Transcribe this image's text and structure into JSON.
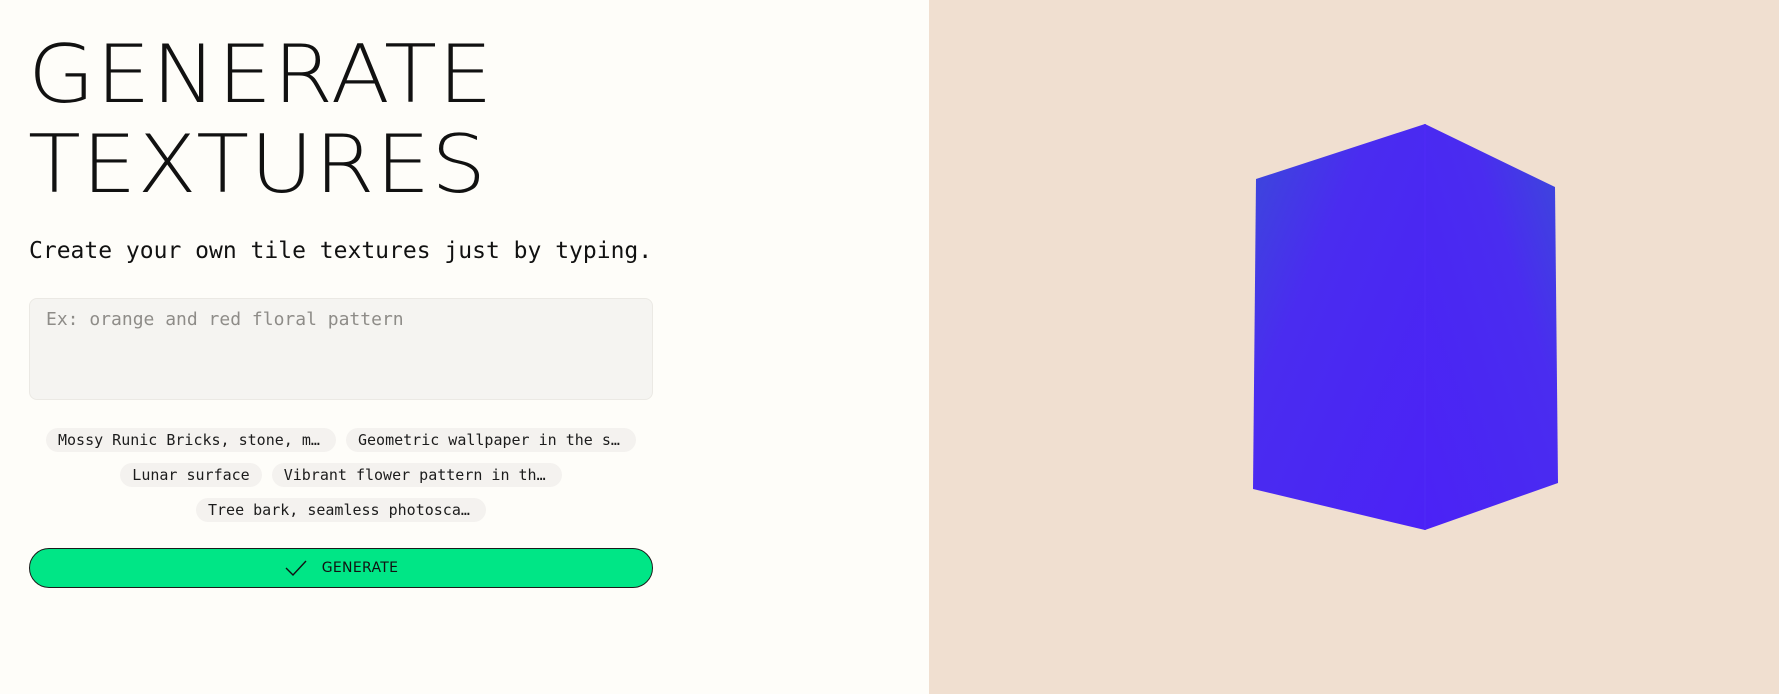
{
  "hero": {
    "title_line1": "GENERATE",
    "title_line2": "TEXTURES",
    "subtitle": "Create your own tile textures just by typing."
  },
  "prompt": {
    "placeholder": "Ex: orange and red floral pattern",
    "value": ""
  },
  "suggestions": [
    "Mossy Runic Bricks, stone, moss",
    "Geometric wallpaper in the sty…",
    "Lunar surface",
    "Vibrant flower pattern in the …",
    "Tree bark, seamless photoscan …"
  ],
  "generate_button": {
    "label": "GENERATE",
    "icon": "check-icon",
    "color": "#00e686"
  },
  "preview": {
    "background": "#f0dfd0",
    "cube_color": "#4b24f5",
    "icon": "cube-preview"
  }
}
